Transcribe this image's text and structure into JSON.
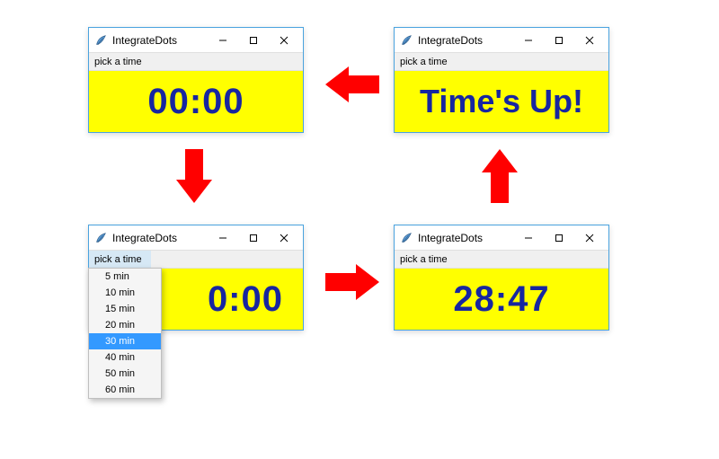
{
  "app_title": "IntegrateDots",
  "menu_label": "pick a time",
  "windows": {
    "initial": {
      "display": "00:00"
    },
    "dropdown": {
      "display": "0:00"
    },
    "running": {
      "display": "28:47"
    },
    "done": {
      "display": "Time's Up!"
    }
  },
  "menu_items": [
    "5 min",
    "10 min",
    "15 min",
    "20 min",
    "30 min",
    "40 min",
    "50 min",
    "60 min"
  ],
  "menu_selected_index": 4
}
